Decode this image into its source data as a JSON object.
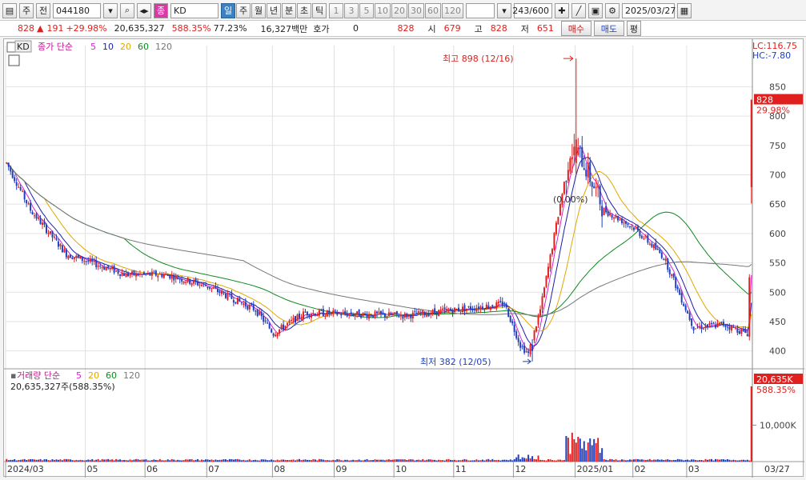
{
  "toolbar": {
    "market": "주",
    "market2": "전",
    "code": "044180",
    "indicator": "KD",
    "periods": [
      "일",
      "주",
      "월",
      "년",
      "분",
      "초",
      "틱"
    ],
    "minutes": [
      "1",
      "3",
      "5",
      "10",
      "20",
      "30",
      "60",
      "120"
    ],
    "count": "243",
    "count_total": "/600",
    "date": "2025/03/27"
  },
  "quote": {
    "price": "828",
    "change": "191",
    "change_pct": "+29.98%",
    "volume": "20,635,327",
    "volume_pct": "588.35%",
    "turnover": "77.23%",
    "amount": "16,327백만",
    "hoga_label": "호가",
    "hoga_value": "0",
    "hoga_price": "828",
    "open_label": "시",
    "open": "679",
    "high_label": "고",
    "high": "828",
    "low_label": "저",
    "low": "651",
    "buy_label": "매수",
    "sell_label": "매도",
    "avg_label": "평"
  },
  "price_panel": {
    "tag": "KD",
    "legend_prefix": "종가 단순",
    "ma_periods": [
      "5",
      "10",
      "20",
      "60",
      "120"
    ],
    "ma_colors": [
      "#d126d1",
      "#1d1da8",
      "#e0a800",
      "#0e8a1e",
      "#777777"
    ],
    "lc_label": "LC:116.75",
    "hc_label": "HC:-7.80",
    "last_price_tag": "828",
    "last_pct_tag": "29.98%",
    "high_label": "최고 898 (12/16)",
    "low_label": "최저 382 (12/05)",
    "mid_label": "(0.00%)"
  },
  "volume_panel": {
    "title": "거래량 단순",
    "ma_periods": [
      "5",
      "20",
      "60",
      "120"
    ],
    "summary": "20,635,327주(588.35%)",
    "last_tag": "20,635K",
    "last_pct": "588.35%",
    "tick_label": "10,000K"
  },
  "chart_data": {
    "type": "candlestick",
    "title": "",
    "y_ticks": [
      400,
      450,
      500,
      550,
      600,
      650,
      700,
      750,
      800,
      850
    ],
    "ylim": [
      375,
      920
    ],
    "x_ticks": [
      "2024/03",
      "05",
      "06",
      "07",
      "08",
      "09",
      "10",
      "11",
      "12",
      "2025/01",
      "02",
      "03"
    ],
    "x_tick_index": [
      0,
      40,
      70,
      101,
      134,
      165,
      195,
      225,
      255,
      286,
      315,
      342
    ],
    "last_date": "03/27",
    "candles": [],
    "max_high": 898,
    "min_low": 382
  },
  "colors": {
    "up": "#e0201e",
    "down": "#1f3fbf",
    "grid": "#e2e2e2"
  }
}
